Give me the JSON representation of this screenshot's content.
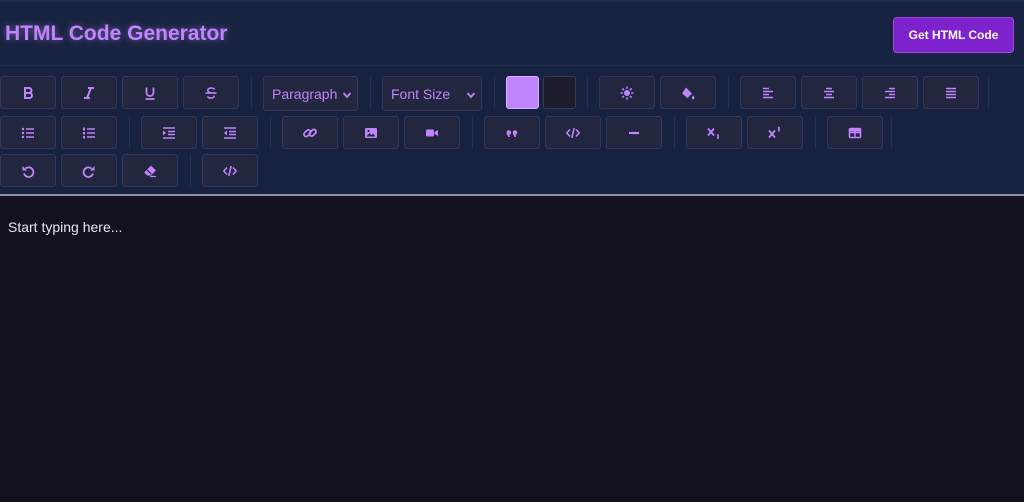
{
  "header": {
    "title": "HTML Code Generator",
    "get_code_label": "Get HTML Code"
  },
  "toolbar": {
    "block_format": {
      "selected": "Paragraph"
    },
    "font_size": {
      "selected": "Font Size"
    },
    "text_color": "#c084fc",
    "background_color": "#1d1c2c",
    "icons": [
      "bold-icon",
      "italic-icon",
      "underline-icon",
      "strikethrough-icon",
      "highlight-icon",
      "fill-color-icon",
      "align-left-icon",
      "align-center-icon",
      "align-right-icon",
      "align-justify-icon",
      "bulleted-list-icon",
      "numbered-list-icon",
      "indent-icon",
      "outdent-icon",
      "link-icon",
      "image-icon",
      "video-icon",
      "blockquote-icon",
      "code-icon",
      "horizontal-rule-icon",
      "subscript-icon",
      "superscript-icon",
      "table-icon",
      "undo-icon",
      "redo-icon",
      "eraser-icon",
      "source-code-icon"
    ]
  },
  "editor": {
    "placeholder": "Start typing here..."
  },
  "colors": {
    "accent": "#c084fc",
    "button_primary": "#7e22ce",
    "header_bg": "#182341",
    "editor_bg": "#12111d"
  }
}
